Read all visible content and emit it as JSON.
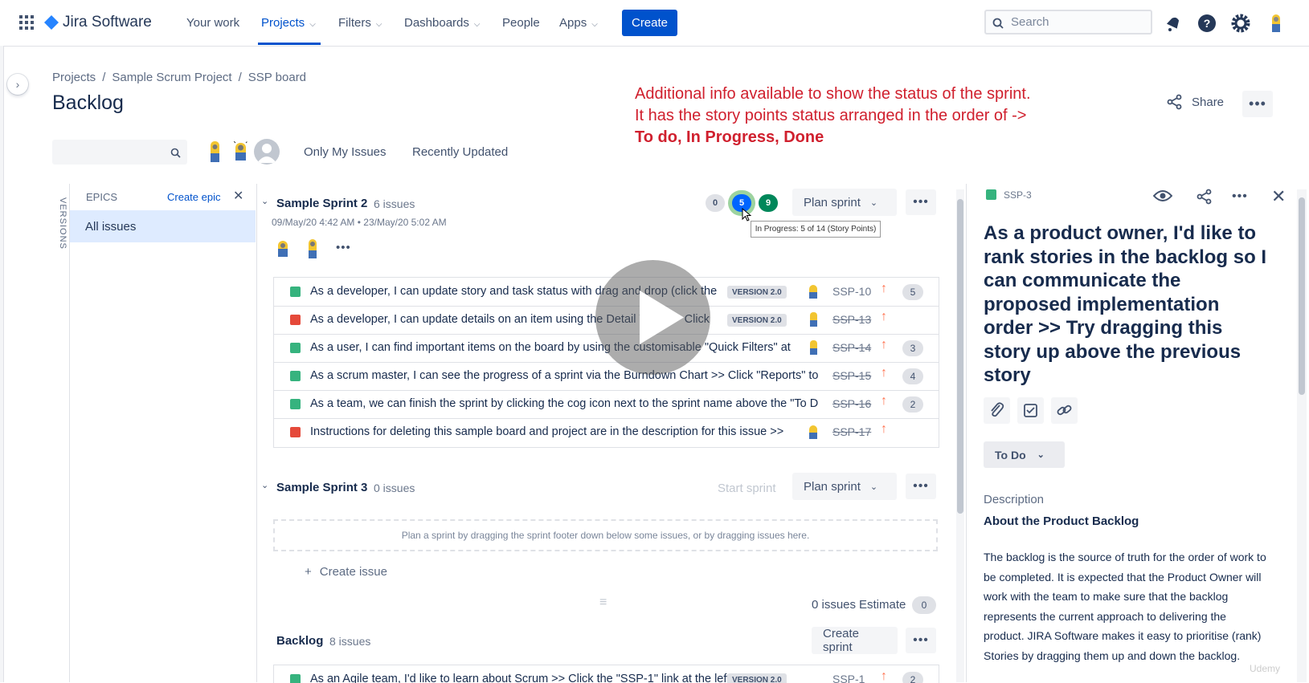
{
  "nav": {
    "product": "Jira Software",
    "items": [
      "Your work",
      "Projects",
      "Filters",
      "Dashboards",
      "People",
      "Apps"
    ],
    "create_label": "Create",
    "search_placeholder": "Search"
  },
  "breadcrumbs": [
    "Projects",
    "Sample Scrum Project",
    "SSP board"
  ],
  "page_title": "Backlog",
  "annotation": {
    "text": "Additional info available to show the status of the sprint. It has the story points status arranged in the order of ->",
    "emphasis": "To do, In Progress, Done"
  },
  "share_label": "Share",
  "quick_filters": [
    "Only My Issues",
    "Recently Updated"
  ],
  "versions_label": "VERSIONS",
  "epics": {
    "heading": "EPICS",
    "create_label": "Create epic",
    "all_issues": "All issues"
  },
  "sprint2": {
    "name": "Sample Sprint 2",
    "count": "6 issues",
    "dates": "09/May/20 4:42 AM • 23/May/20 5:02 AM",
    "points": {
      "todo": "0",
      "in_progress": "5",
      "done": "9"
    },
    "plan_label": "Plan sprint",
    "tooltip": "In Progress: 5 of 14 (Story Points)",
    "issues": [
      {
        "summary": "As a developer, I can update story and task status with drag and drop (click the",
        "version": "VERSION 2.0",
        "key": "SSP-10",
        "points": "5",
        "type": "story",
        "done": false
      },
      {
        "summary": "As a developer, I can update details on an item using the Detail View >> Click",
        "version": "VERSION 2.0",
        "key": "SSP-13",
        "points": "",
        "type": "bug",
        "done": true
      },
      {
        "summary": "As a user, I can find important items on the board by using the customisable \"Quick Filters\" at",
        "version": "",
        "key": "SSP-14",
        "points": "3",
        "type": "story",
        "done": true
      },
      {
        "summary": "As a scrum master, I can see the progress of a sprint via the Burndown Chart >> Click \"Reports\" to",
        "version": "",
        "key": "SSP-15",
        "points": "4",
        "type": "story",
        "done": true
      },
      {
        "summary": "As a team, we can finish the sprint by clicking the cog icon next to the sprint name above the \"To D",
        "version": "",
        "key": "SSP-16",
        "points": "2",
        "type": "story",
        "done": true
      },
      {
        "summary": "Instructions for deleting this sample board and project are in the description for this issue >>",
        "version": "",
        "key": "SSP-17",
        "points": "",
        "type": "bug",
        "done": true
      }
    ]
  },
  "sprint3": {
    "name": "Sample Sprint 3",
    "count": "0 issues",
    "start_label": "Start sprint",
    "plan_label": "Plan sprint",
    "empty_hint": "Plan a sprint by dragging the sprint footer down below some issues, or by dragging issues here.",
    "create_issue": "Create issue",
    "footer_count": "0 issues",
    "estimate_label": "Estimate",
    "estimate_value": "0"
  },
  "backlog": {
    "name": "Backlog",
    "count": "8 issues",
    "create_sprint": "Create sprint",
    "first_issue": {
      "summary": "As an Agile team, I'd like to learn about Scrum >> Click the \"SSP-1\" link at the left of",
      "version": "VERSION 2.0",
      "key": "SSP-1",
      "points": "2"
    }
  },
  "detail": {
    "key": "SSP-3",
    "title": "As a product owner, I'd like to rank stories in the backlog so I can communicate the proposed implementation order >> Try dragging this story up above the previous story",
    "status": "To Do",
    "description_label": "Description",
    "description_heading": "About the Product Backlog",
    "description_text": "The backlog is the source of truth for the order of work to be completed. It is expected that the Product Owner will work with the team to make sure that the backlog represents the current approach to delivering the product. JIRA Software makes it easy to prioritise (rank) Stories by dragging them up and down the backlog."
  },
  "watermark": "Udemy",
  "colors": {
    "primary": "#0052CC",
    "story": "#36B37E",
    "bug": "#E5493A",
    "priority": "#FF7452",
    "annotation": "#D0202E"
  }
}
